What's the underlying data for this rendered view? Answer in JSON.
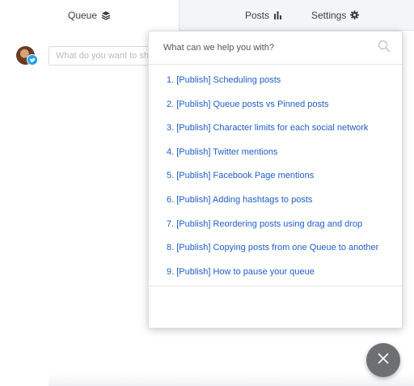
{
  "tabs": {
    "queue": {
      "label": "Queue",
      "icon": "stack-icon",
      "active": true
    },
    "posts": {
      "label": "Posts",
      "icon": "bar-chart-icon"
    },
    "settings": {
      "label": "Settings",
      "icon": "gear-icon"
    }
  },
  "composer": {
    "placeholder": "What do you want to share?",
    "avatar_badge_icon": "twitter-icon"
  },
  "help": {
    "search_placeholder": "What can we help you with?",
    "articles": [
      "1. [Publish] Scheduling posts",
      "2. [Publish] Queue posts vs Pinned posts",
      "3. [Publish] Character limits for each social network",
      "4. [Publish] Twitter mentions",
      "5. [Publish] Facebook Page mentions",
      "6. [Publish] Adding hashtags to posts",
      "7. [Publish] Reordering posts using drag and drop",
      "8. [Publish] Copying posts from one Queue to another",
      "9. [Publish] How to pause your queue"
    ]
  },
  "close_button": {
    "icon": "close-icon"
  },
  "colors": {
    "link": "#1f5fc6",
    "twitter": "#1da1f2",
    "fab": "#6d6f72",
    "tab_inactive_bg": "#f4f5f7"
  }
}
